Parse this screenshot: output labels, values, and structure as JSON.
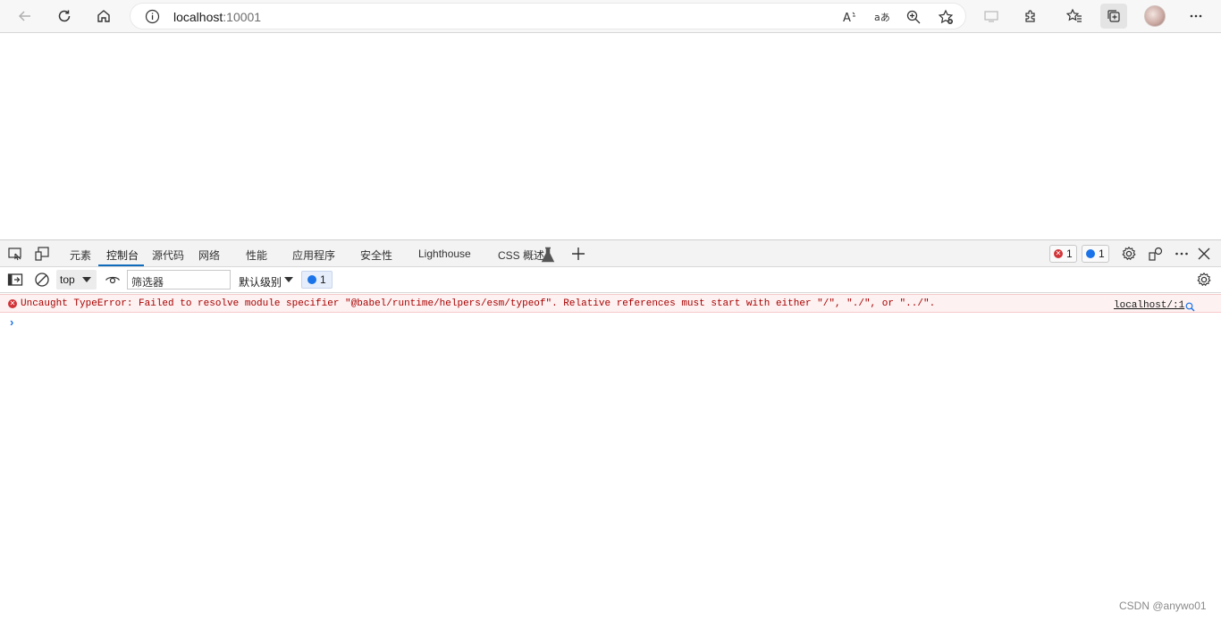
{
  "browser": {
    "address": {
      "host": "localhost",
      "port": ":10001"
    }
  },
  "devtools": {
    "tabs": [
      {
        "label": "元素"
      },
      {
        "label": "控制台"
      },
      {
        "label": "源代码"
      },
      {
        "label": "网络"
      },
      {
        "label": "性能"
      },
      {
        "label": "应用程序"
      },
      {
        "label": "安全性"
      },
      {
        "label": "Lighthouse"
      },
      {
        "label": "CSS 概述"
      }
    ],
    "active_tab": "控制台",
    "error_count": "1",
    "message_count": "1"
  },
  "console": {
    "context": "top",
    "filter_placeholder": "筛选器",
    "levels_label": "默认级别",
    "message_badge_count": "1",
    "error_message": "Uncaught TypeError: Failed to resolve module specifier \"@babel/runtime/helpers/esm/typeof\". Relative references must start with either \"/\", \"./\", or \"../\".",
    "error_source": "localhost/:1"
  },
  "watermark": "CSDN @anywo01",
  "colors": {
    "accent": "#0f6cbd",
    "error": "#d13438",
    "error_text": "#a80000",
    "error_bg": "#fdf1f1",
    "info": "#1a73e8"
  }
}
